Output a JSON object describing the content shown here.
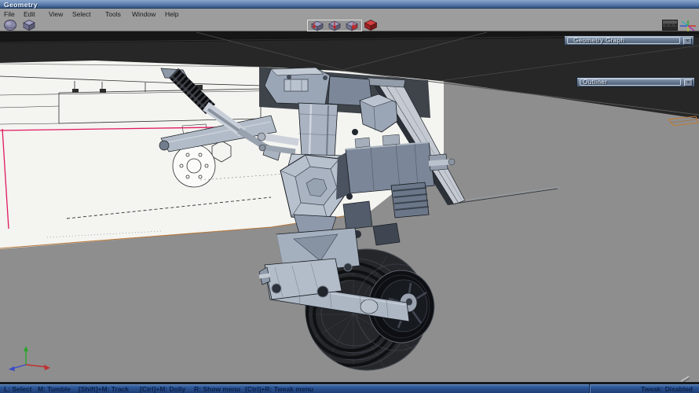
{
  "window": {
    "title": "Geometry"
  },
  "menu_bar": {
    "items": [
      "File",
      "Edit",
      "View",
      "Select",
      "Tools",
      "Window",
      "Help"
    ]
  },
  "toolbar": {
    "left_icons": [
      "rounded-cube",
      "wire-cube"
    ],
    "mode_icons": [
      "cube-arrow-left",
      "cube-arrow-center",
      "cube-arrow-face"
    ],
    "red_icon": "red-cube",
    "right_icons": [
      "shaded-swatch",
      "axis-star"
    ]
  },
  "panels": {
    "geometry_graph": {
      "title": "Geometry Graph",
      "close_label": "×"
    },
    "outliner": {
      "title": "Outliner",
      "close_label": "×"
    }
  },
  "status_bar": {
    "shortcuts": [
      "L: Select",
      "M: Tumble",
      "[Shift]+M: Track",
      "[Ctrl]+M: Dolly",
      "R: Show menu",
      "[Ctrl]+R: Tweak menu"
    ],
    "tweak_status": "Tweak: Disabled"
  },
  "viewport": {
    "axis_colors": {
      "x": "#c03030",
      "y": "#2aa52a",
      "z": "#3a49c8"
    },
    "selection_highlight_color": "#c47a2e",
    "reference_line_color": "#e0195f",
    "background_color": "#8e8e8e"
  }
}
